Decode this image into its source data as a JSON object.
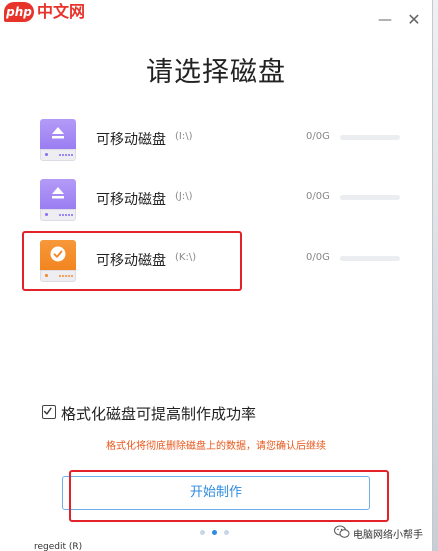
{
  "watermark": {
    "php": "php",
    "text": "中文网"
  },
  "window": {
    "minimize": "—",
    "close": "✕"
  },
  "title": "请选择磁盘",
  "disks": [
    {
      "name": "可移动磁盘",
      "drive": "(I:\\)",
      "size": "0/0G",
      "icon": "eject-icon",
      "color": "#9a7ef2",
      "selected": false
    },
    {
      "name": "可移动磁盘",
      "drive": "(J:\\)",
      "size": "0/0G",
      "icon": "eject-icon",
      "color": "#9a7ef2",
      "selected": false
    },
    {
      "name": "可移动磁盘",
      "drive": "(K:\\)",
      "size": "0/0G",
      "icon": "check-icon",
      "color": "#f28520",
      "selected": true
    }
  ],
  "format_option": {
    "label": "格式化磁盘可提高制作成功率",
    "checked": true
  },
  "warning": "格式化将彻底删除磁盘上的数据，请您确认后继续",
  "start_button": "开始制作",
  "pagination": {
    "count": 3,
    "active": 1
  },
  "footer_watermark": "电脑网络小帮手",
  "bottom_fragment": "regedit (R)",
  "colors": {
    "accent": "#2f8ce0",
    "warning": "#e8571b",
    "highlight": "#e2232a",
    "purple": "#9a7ef2",
    "orange": "#f28520"
  }
}
